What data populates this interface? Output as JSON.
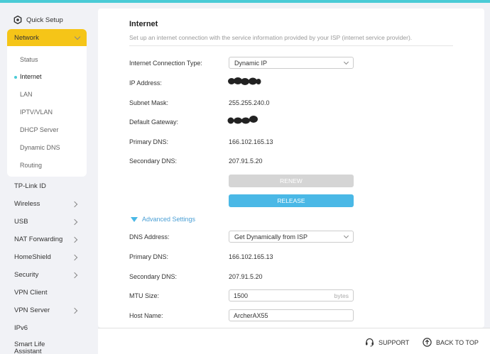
{
  "sidebar": {
    "quick_setup": "Quick Setup",
    "network": "Network",
    "network_items": [
      "Status",
      "Internet",
      "LAN",
      "IPTV/VLAN",
      "DHCP Server",
      "Dynamic DNS",
      "Routing"
    ],
    "active_item": "Internet",
    "menu": [
      {
        "label": "TP-Link ID",
        "chevron": false
      },
      {
        "label": "Wireless",
        "chevron": true
      },
      {
        "label": "USB",
        "chevron": true
      },
      {
        "label": "NAT Forwarding",
        "chevron": true
      },
      {
        "label": "HomeShield",
        "chevron": true
      },
      {
        "label": "Security",
        "chevron": true
      },
      {
        "label": "VPN Client",
        "chevron": false
      },
      {
        "label": "VPN Server",
        "chevron": true
      },
      {
        "label": "IPv6",
        "chevron": false
      },
      {
        "label": "Smart Life Assistant",
        "chevron": false
      }
    ]
  },
  "internet": {
    "title": "Internet",
    "subtitle": "Set up an internet connection with the service information provided by your ISP (internet service provider).",
    "connection_type_label": "Internet Connection Type:",
    "connection_type_value": "Dynamic IP",
    "ip_label": "IP Address:",
    "subnet_label": "Subnet Mask:",
    "subnet_value": "255.255.240.0",
    "gateway_label": "Default Gateway:",
    "primary_dns_label": "Primary DNS:",
    "primary_dns_value": "166.102.165.13",
    "secondary_dns_label": "Secondary DNS:",
    "secondary_dns_value": "207.91.5.20",
    "renew_label": "RENEW",
    "release_label": "RELEASE"
  },
  "advanced": {
    "toggle_label": "Advanced Settings",
    "dns_address_label": "DNS Address:",
    "dns_address_value": "Get Dynamically from ISP",
    "primary_dns_label": "Primary DNS:",
    "primary_dns_value": "166.102.165.13",
    "secondary_dns_label": "Secondary DNS:",
    "secondary_dns_value": "207.91.5.20",
    "mtu_label": "MTU Size:",
    "mtu_value": "1500",
    "mtu_unit": "bytes",
    "host_label": "Host Name:",
    "host_value": "ArcherAX55"
  },
  "footer": {
    "support": "SUPPORT",
    "back_to_top": "BACK TO TOP"
  },
  "colors": {
    "accent": "#4acbd6",
    "network_highlight": "#f5c518",
    "release_button": "#4ab8e6",
    "renew_button": "#d5d5d5"
  }
}
